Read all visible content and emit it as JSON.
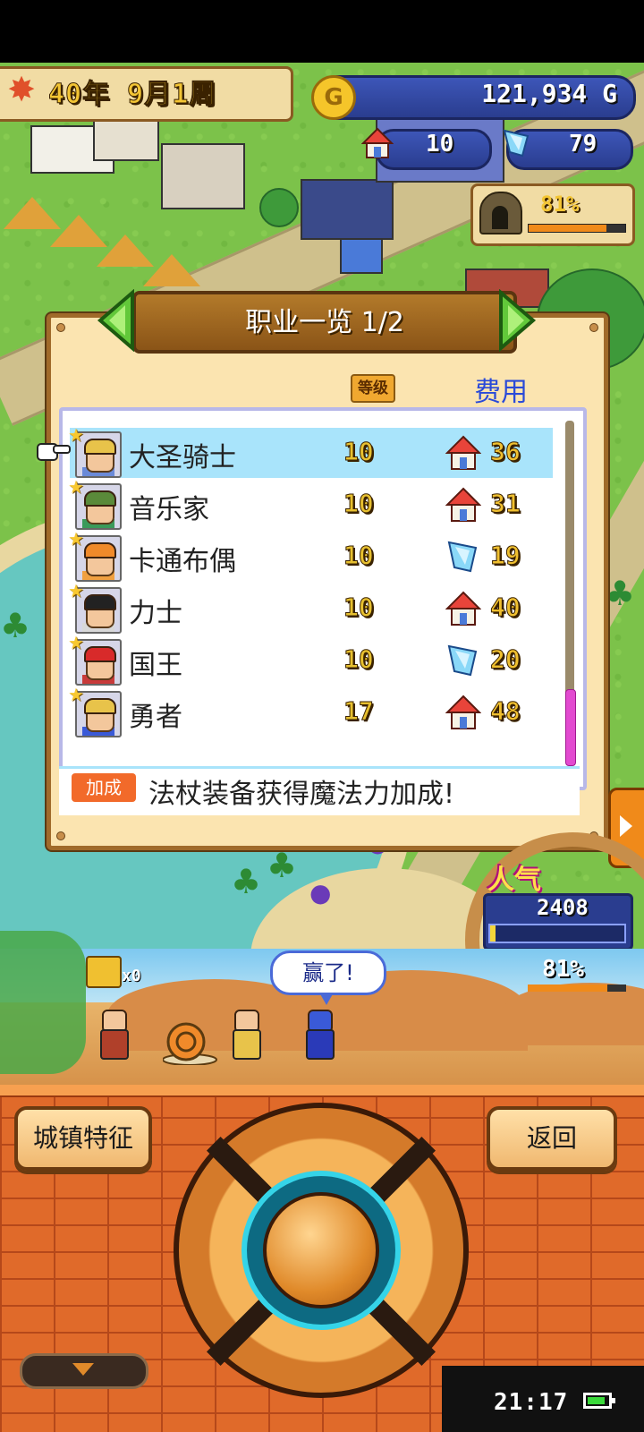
{
  "hud": {
    "date": "40年 9月1周",
    "money": "121,934 G",
    "coin_letter": "G",
    "houses": "10",
    "crystals": "79",
    "facility_pct": 81,
    "facility_pct_text": "81%"
  },
  "dialog": {
    "title": "职业一览 1/2",
    "col_level": "等级",
    "col_cost": "费用",
    "jobs": [
      {
        "name": "大圣骑士",
        "level": "10",
        "cost": "36",
        "cost_icon": "house-icon",
        "selected": true,
        "hair": "#e8c34a",
        "outfit": "#6a8ad8"
      },
      {
        "name": "音乐家",
        "level": "10",
        "cost": "31",
        "cost_icon": "house-icon",
        "selected": false,
        "hair": "#5a8a3a",
        "outfit": "#3a9a5a"
      },
      {
        "name": "卡通布偶",
        "level": "10",
        "cost": "19",
        "cost_icon": "crystal-icon",
        "selected": false,
        "hair": "#f08a2a",
        "outfit": "#f0a040"
      },
      {
        "name": "力士",
        "level": "10",
        "cost": "40",
        "cost_icon": "house-icon",
        "selected": false,
        "hair": "#222222",
        "outfit": "#d8d8d8"
      },
      {
        "name": "国王",
        "level": "10",
        "cost": "20",
        "cost_icon": "crystal-icon",
        "selected": false,
        "hair": "#d82a2a",
        "outfit": "#c83a3a"
      },
      {
        "name": "勇者",
        "level": "17",
        "cost": "48",
        "cost_icon": "house-icon",
        "selected": false,
        "hair": "#e8c34a",
        "outfit": "#3a5ad8"
      }
    ],
    "bonus_badge": "加成",
    "bonus_text": "法杖装备获得魔法力加成!"
  },
  "popularity": {
    "label": "人气",
    "value": "2408",
    "level": 0.04
  },
  "battle": {
    "chest_count": "x0",
    "speech": "赢了!",
    "pct_text": "81%",
    "pct": 81
  },
  "controls": {
    "town_features": "城镇特征",
    "back": "返回"
  },
  "status": {
    "time": "21:17",
    "battery_level": 0.85
  },
  "colors": {
    "frame_brown": "#a06a2a",
    "cost_blue": "#2a4ad8",
    "selected_row": "#a9e4fb",
    "popularity_pink": "#b0107a"
  }
}
